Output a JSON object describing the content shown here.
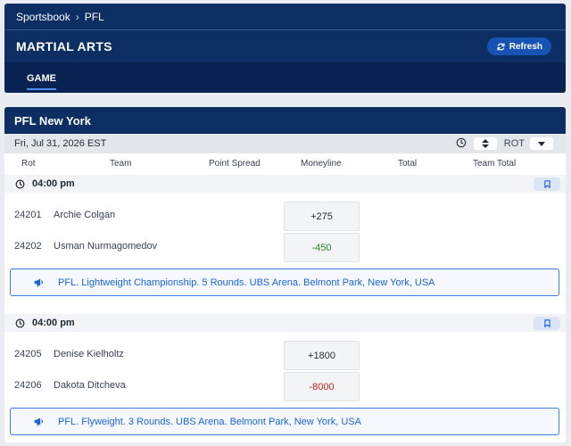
{
  "breadcrumb": {
    "root": "Sportsbook",
    "current": "PFL"
  },
  "header": {
    "title": "MARTIAL ARTS",
    "refresh_label": "Refresh",
    "tab": "GAME"
  },
  "event": {
    "title": "PFL New York",
    "date": "Fri, Jul 31, 2026 EST",
    "sort_label": "ROT",
    "columns": [
      "Rot",
      "Team",
      "Point Spread",
      "Moneyline",
      "Total",
      "Team Total"
    ]
  },
  "games": [
    {
      "time": "04:00 pm",
      "rows": [
        {
          "rot": "24201",
          "team": "Archie Colgan",
          "moneyline": "+275"
        },
        {
          "rot": "24202",
          "team": "Usman Nurmagomedov",
          "moneyline": "-450"
        }
      ],
      "info": "PFL. Lightweight Championship. 5 Rounds. UBS Arena. Belmont Park, New York, USA"
    },
    {
      "time": "04:00 pm",
      "rows": [
        {
          "rot": "24205",
          "team": "Denise Kielholtz",
          "moneyline": "+1800"
        },
        {
          "rot": "24206",
          "team": "Dakota Ditcheva",
          "moneyline": "-8000"
        }
      ],
      "info": "PFL. Flyweight. 3 Rounds. UBS Arena. Belmont Park, New York, USA"
    }
  ],
  "colors": {
    "navy": "#0c2e63",
    "accent": "#1d63d6",
    "negative_favorite_green": "#228b22",
    "negative_favorite_red": "#c0241c"
  }
}
